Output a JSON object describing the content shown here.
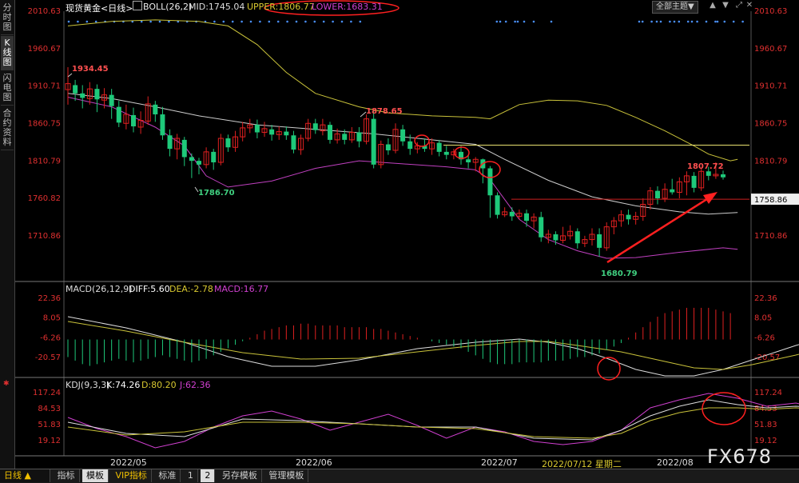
{
  "sidebar": {
    "tabs": [
      "分时图",
      "K线图",
      "闪电图",
      "合约资料"
    ],
    "active": 1
  },
  "header": {
    "main": {
      "title": "现货黄金<日线>",
      "boll": "BOLL(26,2)",
      "mid": "MID:1745.04",
      "upper": "UPPER:1806.77",
      "lower": "LOWER:1683.31"
    },
    "macd": {
      "title": "MACD(26,12,9)",
      "diff": "DIFF:5.60",
      "dea": "DEA:-2.78",
      "macd": "MACD:16.77"
    },
    "kdj": {
      "title": "KDJ(9,3,3)",
      "k": "K:74.26",
      "d": "D:80.20",
      "j": "J:62.36"
    },
    "topright": {
      "theme_label": "全部主题",
      "theme_arrow": "▼"
    }
  },
  "axes": {
    "main_left": [
      "2010.63",
      "1960.67",
      "1910.71",
      "1860.75",
      "1810.79",
      "1760.82",
      "1710.86"
    ],
    "main_right": [
      "2010.63",
      "1960.67",
      "1910.71",
      "1860.75",
      "1810.79",
      "1760.82",
      "1710.86"
    ],
    "main_right_highlight": "1758.86",
    "macd_ticks": [
      "22.36",
      "8.05",
      "-6.26",
      "-20.57"
    ],
    "kdj_ticks": [
      "117.24",
      "84.53",
      "51.83",
      "19.12"
    ],
    "dates": [
      "2022/05",
      "2022/06",
      "2022/07",
      "2022/07/12 星期二",
      "2022/08"
    ]
  },
  "annotations": {
    "hi1": "1934.45",
    "lo1": "1786.70",
    "hi2": "1878.65",
    "lo2": "1680.79",
    "hi3": "1807.72"
  },
  "bottom": {
    "period_label": "日线 ▲",
    "tabs": [
      "指标",
      "模板",
      "VIP指标",
      "标准",
      "1",
      "2",
      "另存模板",
      "管理模板"
    ],
    "active_tabs": [
      1,
      5
    ]
  },
  "watermark": "FX678",
  "colors": {
    "up": "#e02020",
    "down": "#1ec97a",
    "mid": "#cccccc",
    "upper": "#c9c23a",
    "lower": "#c040c0",
    "hline": "#e8e070",
    "redline": "#cc2020"
  }
}
